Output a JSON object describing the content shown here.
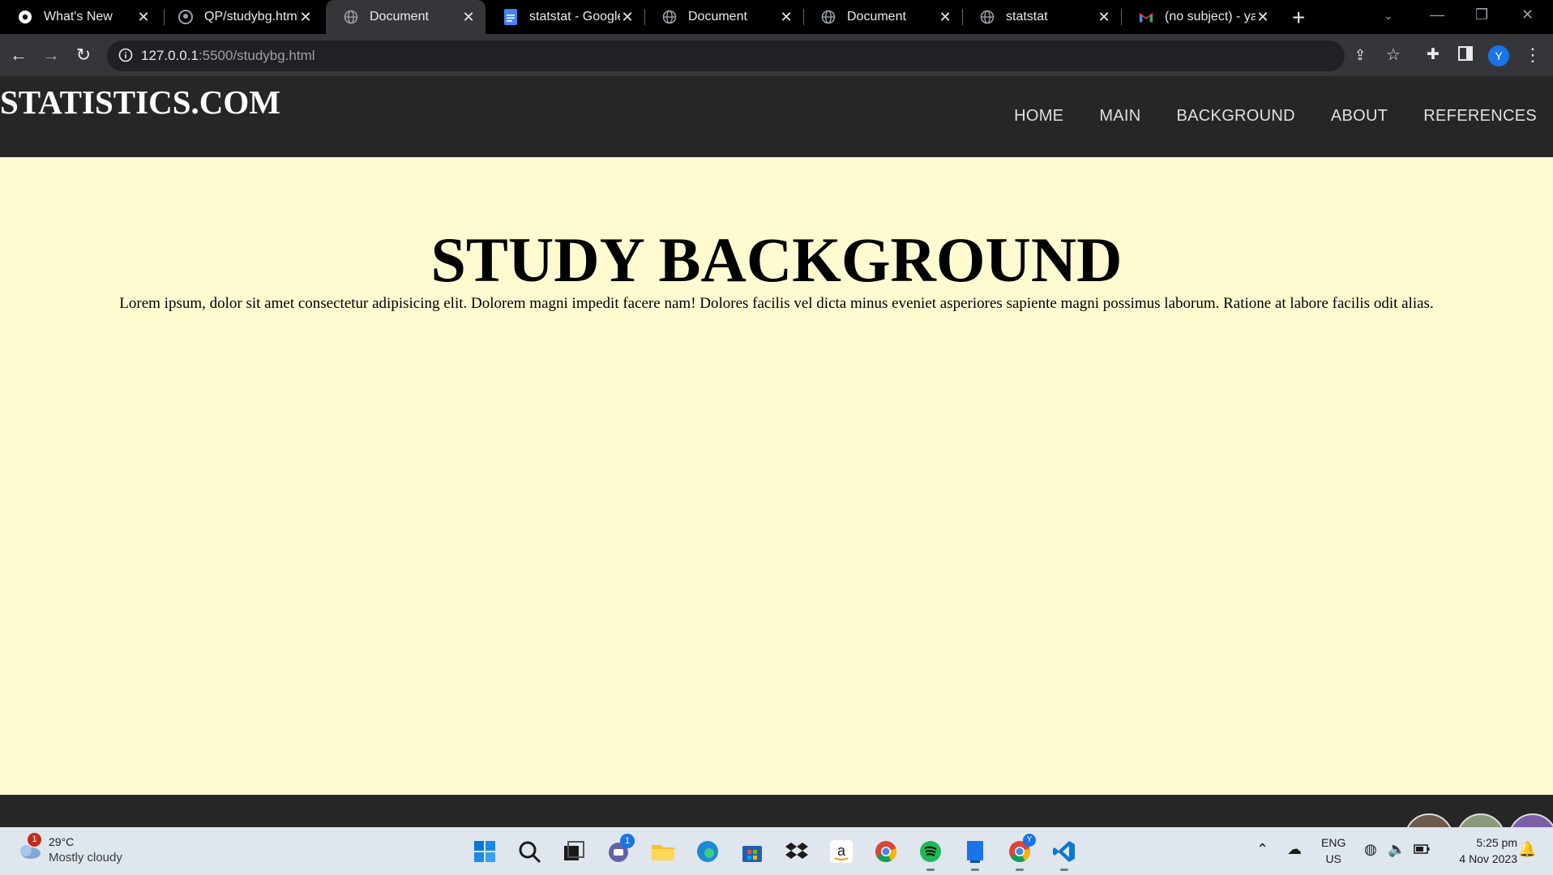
{
  "browser": {
    "tabs": [
      {
        "title": "What's New",
        "icon": "chrome-icon",
        "active": false
      },
      {
        "title": "QP/studybg.html",
        "icon": "github-icon",
        "active": false
      },
      {
        "title": "Document",
        "icon": "globe-icon",
        "active": true
      },
      {
        "title": "statstat - Google",
        "icon": "google-docs-icon",
        "active": false
      },
      {
        "title": "Document",
        "icon": "globe-icon",
        "active": false
      },
      {
        "title": "Document",
        "icon": "globe-icon",
        "active": false
      },
      {
        "title": "statstat",
        "icon": "globe-icon",
        "active": false
      },
      {
        "title": "(no subject) - ya",
        "icon": "gmail-icon",
        "active": false
      }
    ],
    "url_host": "127.0.0.1",
    "url_rest": ":5500/studybg.html",
    "profile_initial": "Y",
    "colors": {
      "tabstrip": "#000000",
      "toolbar": "#35363a",
      "omnibox": "#202124",
      "profile": "#1a73e8"
    }
  },
  "site": {
    "logo": "STATISTICS.COM",
    "nav": [
      "HOME",
      "MAIN",
      "BACKGROUND",
      "ABOUT",
      "REFERENCES"
    ],
    "heading": "STUDY BACKGROUND",
    "paragraph": "Lorem ipsum, dolor sit amet consectetur adipisicing elit. Dolorem magni impedit facere nam! Dolores facilis vel dicta minus eveniet asperiores sapiente magni possimus laborum. Ratione at labore facilis odit alias.",
    "colors": {
      "header": "#262626",
      "body": "#fffbd1",
      "text": "#000000"
    }
  },
  "taskbar": {
    "weather_badge": "1",
    "temperature": "29°C",
    "weather": "Mostly cloudy",
    "teams_badge": "1",
    "chrome_badge": "Y",
    "apps": [
      "start-icon",
      "search-icon",
      "task-view-icon",
      "teams-chat-icon",
      "file-explorer-icon",
      "edge-icon",
      "microsoft-store-icon",
      "dropbox-icon",
      "amazon-icon",
      "chrome-icon",
      "spotify-icon",
      "app-icon",
      "chrome-profile-icon",
      "vscode-icon"
    ],
    "lang_line1": "ENG",
    "lang_line2": "US",
    "time": "5:25 pm",
    "date": "4 Nov 2023"
  }
}
